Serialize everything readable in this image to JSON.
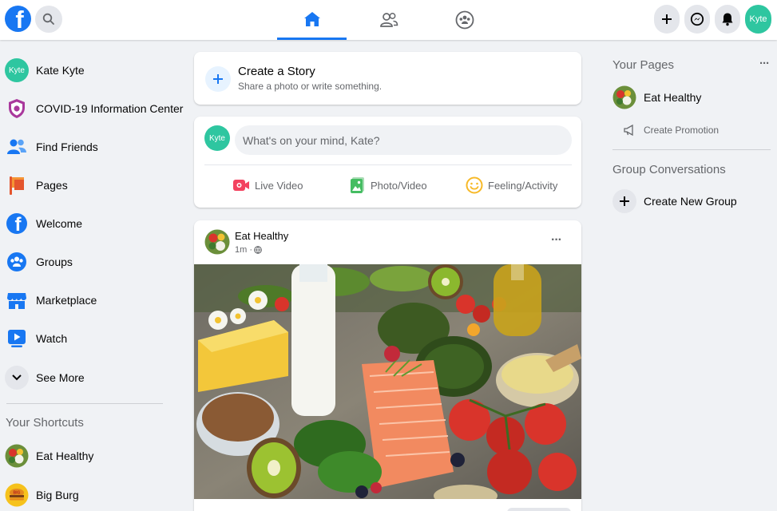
{
  "topbar": {
    "logo_letter": "f",
    "avatar_text": "Kyte"
  },
  "sidebar": {
    "items": [
      {
        "label": "Kate Kyte",
        "icon": "profile-avatar"
      },
      {
        "label": "COVID-19 Information Center",
        "icon": "covid-shield-icon"
      },
      {
        "label": "Find Friends",
        "icon": "friends-icon"
      },
      {
        "label": "Pages",
        "icon": "pages-flag-icon"
      },
      {
        "label": "Welcome",
        "icon": "facebook-icon"
      },
      {
        "label": "Groups",
        "icon": "groups-icon"
      },
      {
        "label": "Marketplace",
        "icon": "marketplace-icon"
      },
      {
        "label": "Watch",
        "icon": "watch-icon"
      },
      {
        "label": "See More",
        "icon": "chevron-down-icon"
      }
    ],
    "avatar_text": "Kyte",
    "shortcuts_title": "Your Shortcuts",
    "shortcuts": [
      {
        "label": "Eat Healthy"
      },
      {
        "label": "Big Burg"
      }
    ]
  },
  "story": {
    "title": "Create a Story",
    "subtitle": "Share a photo or write something."
  },
  "composer": {
    "avatar_text": "Kyte",
    "placeholder": "What's on your mind, Kate?",
    "actions": [
      {
        "label": "Live Video",
        "color": "#f3425f"
      },
      {
        "label": "Photo/Video",
        "color": "#45bd62"
      },
      {
        "label": "Feeling/Activity",
        "color": "#f7b928"
      }
    ]
  },
  "post": {
    "author": "Eat Healthy",
    "time": "1m ·",
    "more": "···"
  },
  "right": {
    "pages_title": "Your Pages",
    "pages_more": "···",
    "page_name": "Eat Healthy",
    "promotion": "Create Promotion",
    "groups_title": "Group Conversations",
    "new_group": "Create New Group"
  },
  "colors": {
    "accent": "#1877f2",
    "avatar": "#2ec6a0"
  }
}
